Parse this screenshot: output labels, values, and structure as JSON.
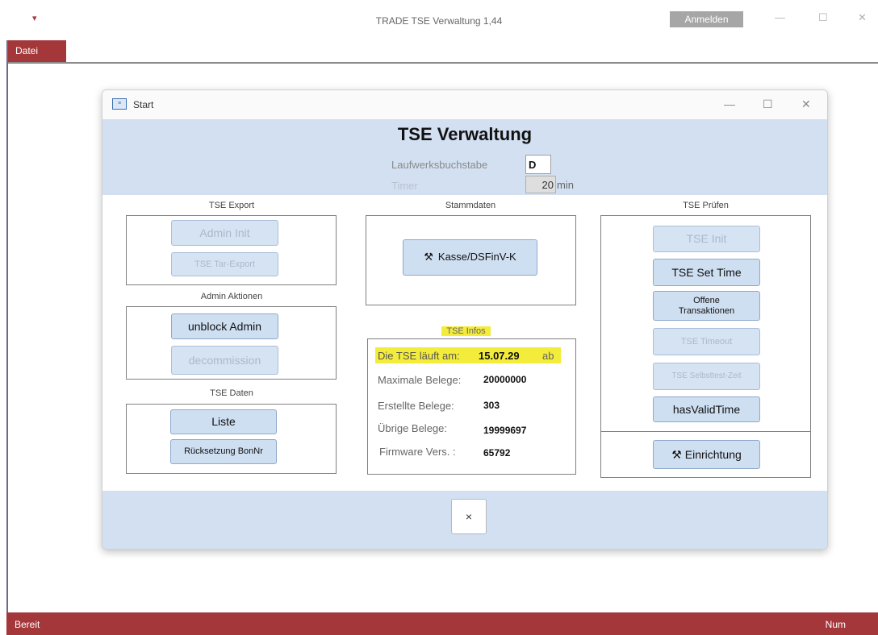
{
  "app": {
    "title": "TRADE TSE Verwaltung 1,44",
    "login_button": "Anmelden",
    "menu_icon": "▾",
    "controls": {
      "minimize": "—",
      "maximize": "☐",
      "close": "✕"
    }
  },
  "ribbon": {
    "tab_datei": "Datei"
  },
  "status": {
    "left": "Bereit",
    "right": "Num"
  },
  "form": {
    "window_title": "Start",
    "form_icon_glyph": "≡",
    "controls": {
      "minimize": "—",
      "maximize": "☐",
      "close": "✕"
    },
    "title": "TSE Verwaltung",
    "laufwerk_label": "Laufwerksbuchstabe",
    "laufwerk_value": "D",
    "timer_label": "Timer",
    "timer_value": "20",
    "timer_unit": "min",
    "close_button": "×"
  },
  "export": {
    "label": "TSE Export",
    "admin_init": "Admin Init",
    "tar_export": "TSE Tar-Export"
  },
  "admin": {
    "label": "Admin Aktionen",
    "unblock": "unblock Admin",
    "decommission": "decommission"
  },
  "daten": {
    "label": "TSE Daten",
    "liste": "Liste",
    "ruecksetzung": "Rücksetzung BonNr"
  },
  "stammdaten": {
    "label": "Stammdaten",
    "kasse_button": "Kasse/DSFinV-K",
    "tool_icon": "⚒"
  },
  "infos": {
    "label": "TSE Infos",
    "laeuft_label": "Die TSE läuft am:",
    "laeuft_value": "15.07.29",
    "laeuft_suffix": "ab",
    "max_label": "Maximale Belege:",
    "max_value": "20000000",
    "erstellt_label": "Erstellte Belege:",
    "erstellt_value": "303",
    "uebrig_label": "Übrige Belege:",
    "uebrig_value": "19999697",
    "firmware_label": "Firmware Vers. :",
    "firmware_value": "65792"
  },
  "pruefen": {
    "label": "TSE Prüfen",
    "init": "TSE Init",
    "set_time": "TSE Set Time",
    "offene_line1": "Offene",
    "offene_line2": "Transaktionen",
    "timeout": "TSE Timeout",
    "selbsttest": "TSE Selbsttest-Zeit",
    "has_valid_time": "hasValidTime",
    "einrichtung": "Einrichtung",
    "tool_icon": "⚒"
  },
  "colors": {
    "accent_red": "#a4373a",
    "band_blue": "#d2e0f2",
    "button_blue": "#cfdff2",
    "highlight_yellow": "#f4ec3a"
  }
}
